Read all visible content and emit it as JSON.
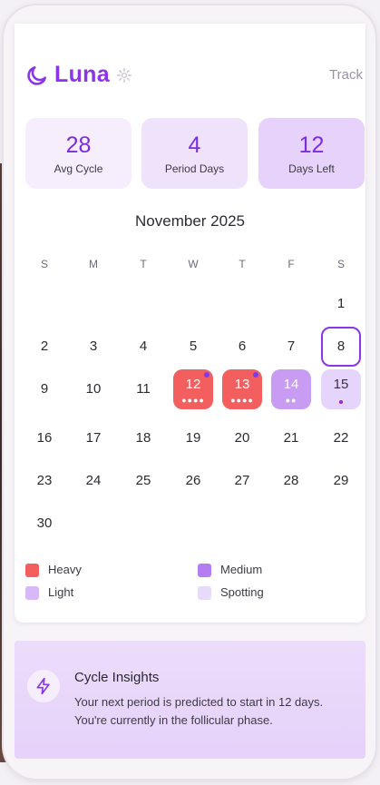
{
  "app": {
    "title": "Luna",
    "track_label": "Track"
  },
  "stats": [
    {
      "value": "28",
      "label": "Avg Cycle"
    },
    {
      "value": "4",
      "label": "Period Days"
    },
    {
      "value": "12",
      "label": "Days Left"
    }
  ],
  "calendar": {
    "month_label": "November 2025",
    "weekdays": [
      "S",
      "M",
      "T",
      "W",
      "T",
      "F",
      "S"
    ],
    "days": [
      "1",
      "2",
      "3",
      "4",
      "5",
      "6",
      "7",
      "8",
      "9",
      "10",
      "11",
      "12",
      "13",
      "14",
      "15",
      "16",
      "17",
      "18",
      "19",
      "20",
      "21",
      "22",
      "23",
      "24",
      "25",
      "26",
      "27",
      "28",
      "29",
      "30"
    ],
    "selected_day": "8",
    "period_days": [
      {
        "day": "12",
        "flow": "Heavy"
      },
      {
        "day": "13",
        "flow": "Heavy"
      },
      {
        "day": "14",
        "flow": "Medium"
      },
      {
        "day": "15",
        "flow": "Light"
      }
    ]
  },
  "legend": [
    {
      "label": "Heavy",
      "color": "#f35e5e"
    },
    {
      "label": "Medium",
      "color": "#b57ef0"
    },
    {
      "label": "Light",
      "color": "#d7b8f8"
    },
    {
      "label": "Spotting",
      "color": "#e8daf9"
    }
  ],
  "insights": {
    "title": "Cycle Insights",
    "body": "Your next period is predicted to start in 12 days. You're currently in the follicular phase."
  },
  "colors": {
    "accent": "#8b35e8",
    "heavy": "#f35e5e",
    "medium": "#c89cf2",
    "light": "#e5d4fb"
  },
  "icons": {
    "logo": "moon-icon",
    "settings": "gear-icon",
    "insights": "lightning-icon"
  }
}
